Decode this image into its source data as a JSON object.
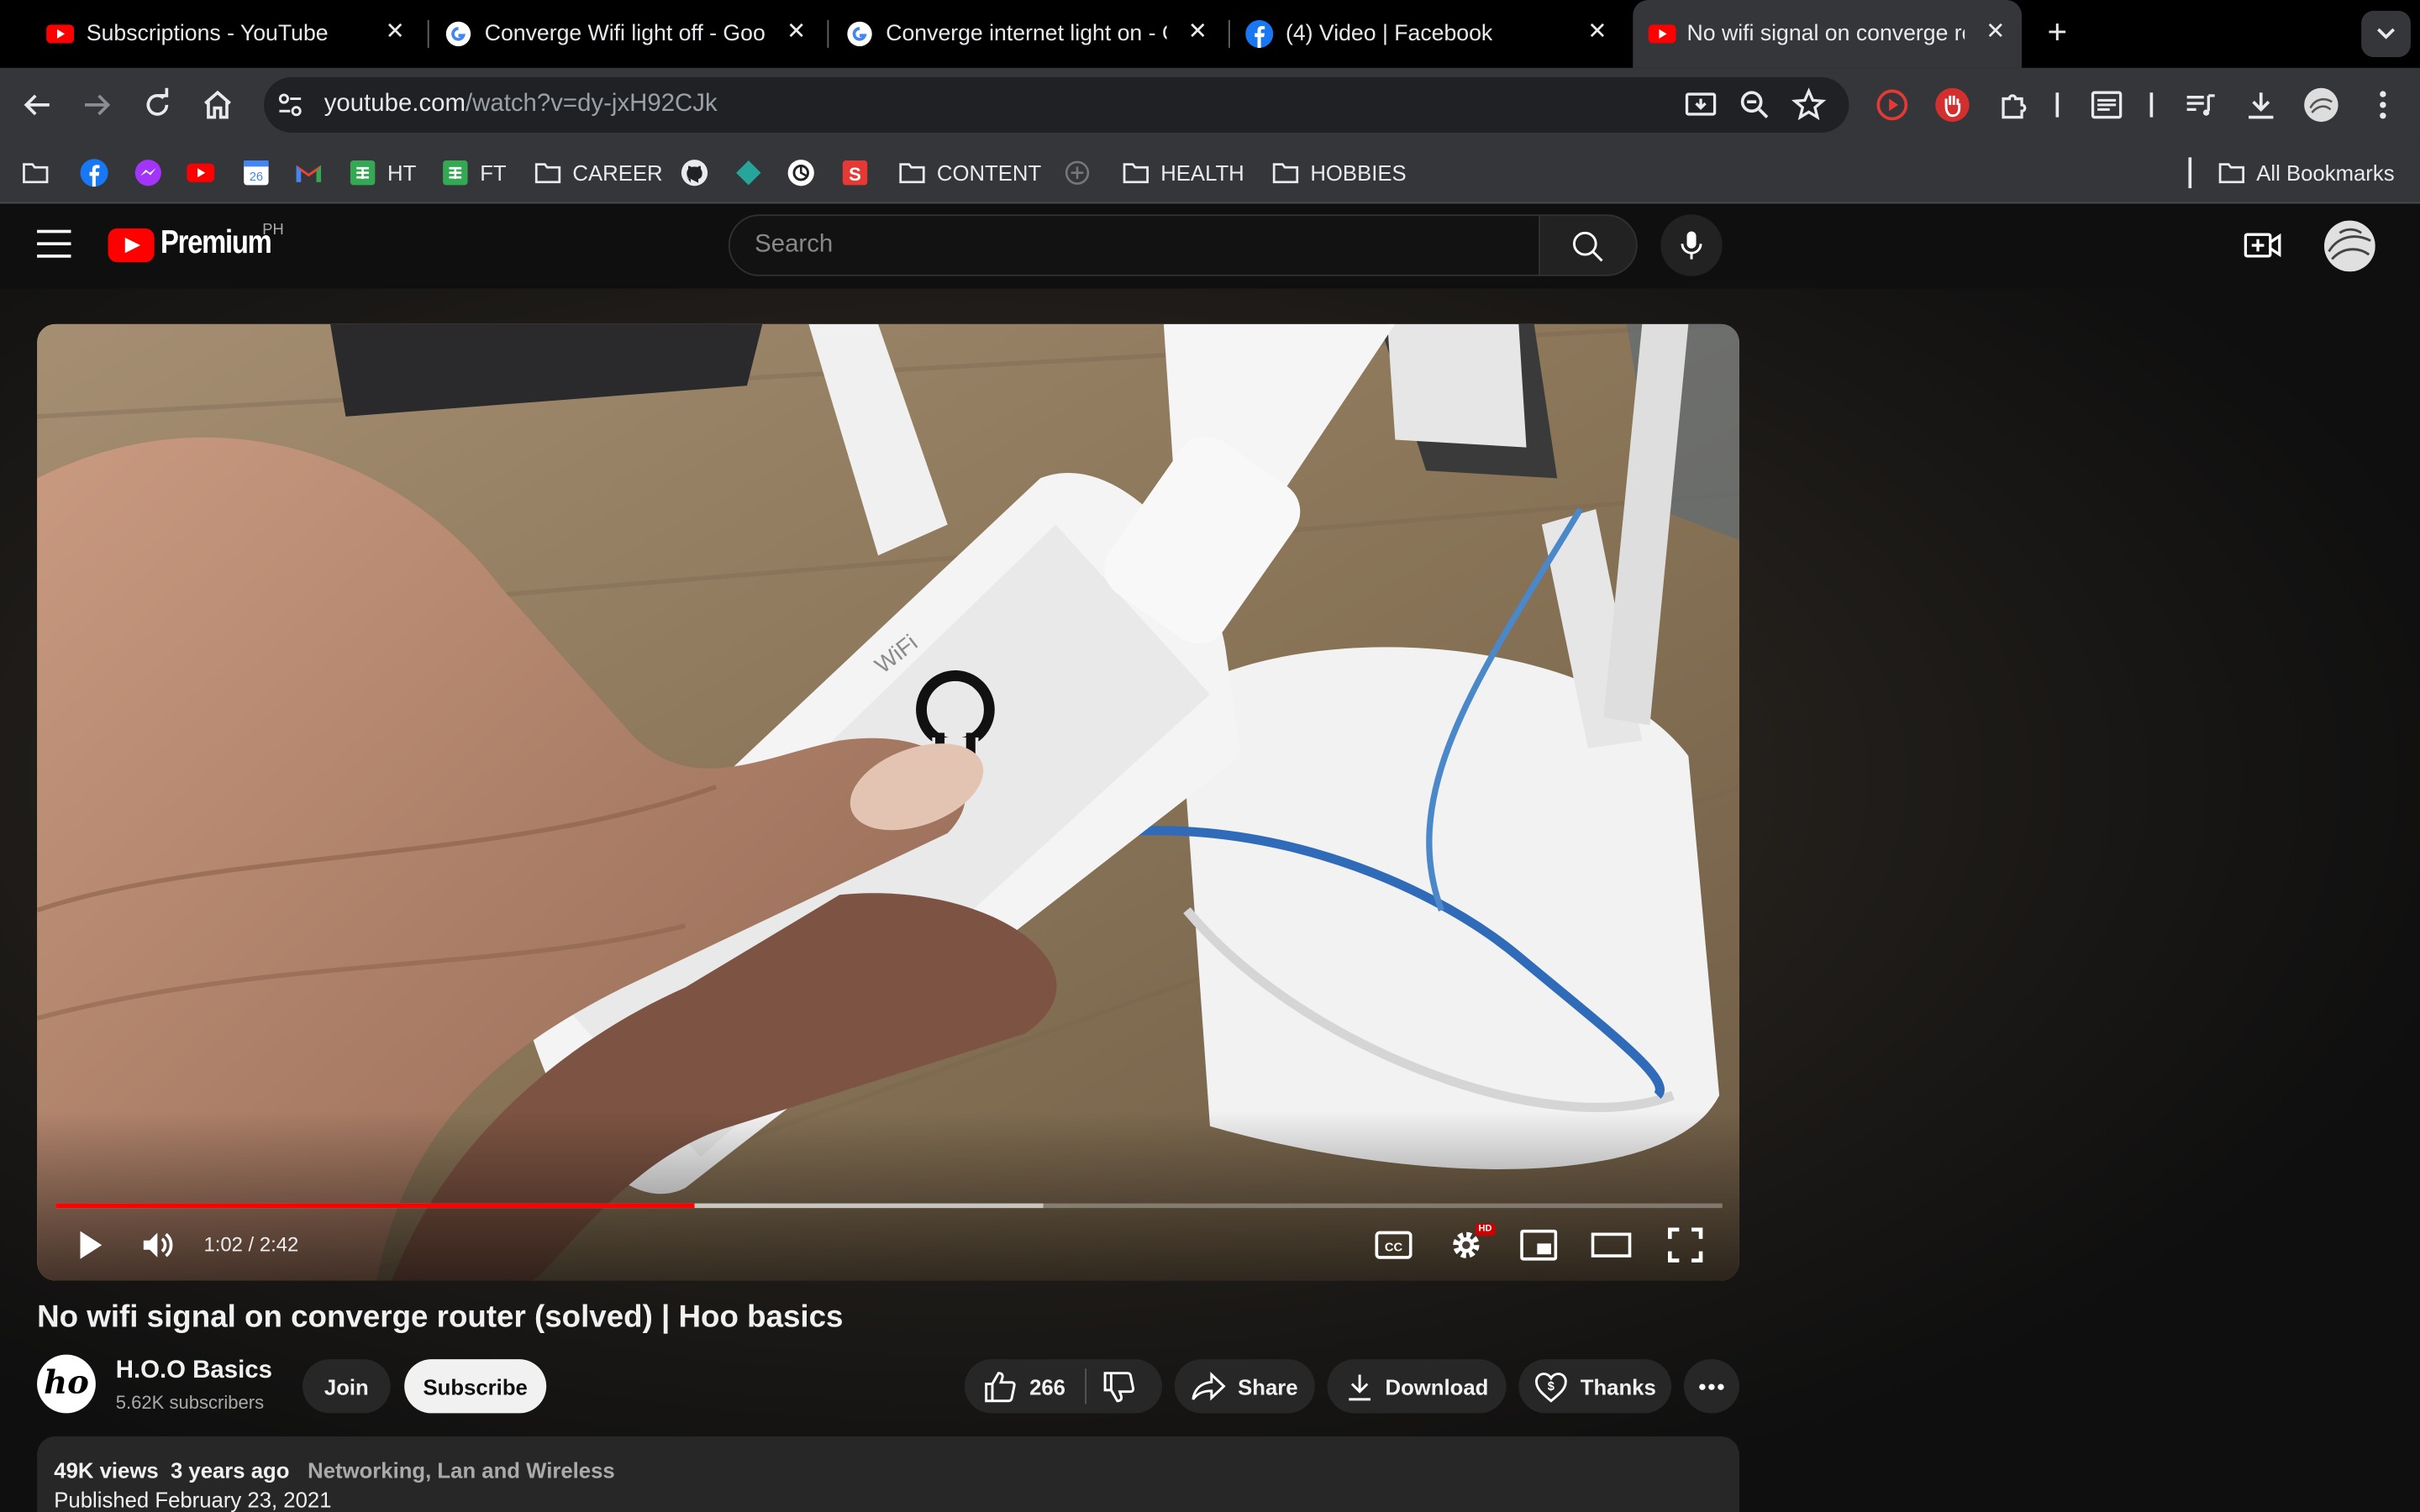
{
  "browser": {
    "tabs": [
      {
        "title": "Subscriptions - YouTube",
        "favicon": "youtube-icon"
      },
      {
        "title": "Converge Wifi light off - Goog",
        "favicon": "google-icon"
      },
      {
        "title": "Converge internet light on - G",
        "favicon": "google-icon"
      },
      {
        "title": "(4) Video | Facebook",
        "favicon": "facebook-icon"
      },
      {
        "title": "No wifi signal on converge ro",
        "favicon": "youtube-icon",
        "active": true
      }
    ],
    "url_host": "youtube.com",
    "url_path": "/watch?v=dy-jxH92CJk",
    "bookmarks": [
      {
        "label": "",
        "icon": "folder-icon"
      },
      {
        "label": "",
        "icon": "facebook-icon"
      },
      {
        "label": "",
        "icon": "messenger-icon"
      },
      {
        "label": "",
        "icon": "youtube-icon"
      },
      {
        "label": "",
        "icon": "calendar-icon"
      },
      {
        "label": "",
        "icon": "gmail-icon"
      },
      {
        "label": "HT",
        "icon": "sheets-icon"
      },
      {
        "label": "FT",
        "icon": "sheets-icon"
      },
      {
        "label": "CAREER",
        "icon": "folder-icon"
      },
      {
        "label": "",
        "icon": "github-icon"
      },
      {
        "label": "",
        "icon": "diamond-icon"
      },
      {
        "label": "",
        "icon": "openai-icon"
      },
      {
        "label": "",
        "icon": "s-app-icon"
      },
      {
        "label": "CONTENT",
        "icon": "folder-icon"
      },
      {
        "label": "",
        "icon": "plus-circle-icon"
      },
      {
        "label": "HEALTH",
        "icon": "folder-icon"
      },
      {
        "label": "HOBBIES",
        "icon": "folder-icon"
      }
    ],
    "all_bookmarks": "All Bookmarks"
  },
  "youtube": {
    "brand": "Premium",
    "region": "PH",
    "search_placeholder": "Search",
    "player": {
      "time": "1:02 / 2:42",
      "progress_fraction": 0.383,
      "buffered_fraction": 0.593,
      "hd_badge": "HD",
      "video_text": "WiFi"
    },
    "video": {
      "title": "No wifi signal on converge router (solved) | Hoo basics",
      "channel": "H.O.O Basics",
      "channel_initials": "ho",
      "subscribers": "5.62K subscribers",
      "join": "Join",
      "subscribe": "Subscribe",
      "likes": "266",
      "share": "Share",
      "download": "Download",
      "thanks": "Thanks",
      "views": "49K views",
      "age": "3 years ago",
      "category": "Networking, Lan and Wireless",
      "published": "Published February 23, 2021"
    }
  }
}
